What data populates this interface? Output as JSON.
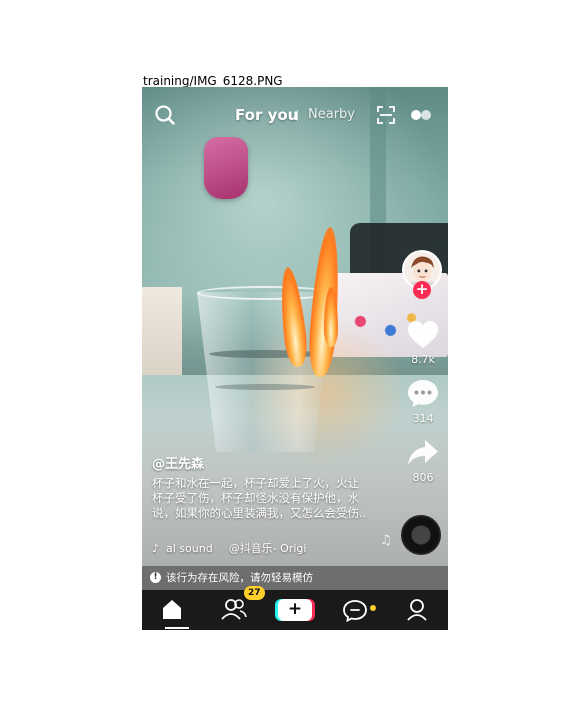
{
  "file_caption": "training/IMG_6128.PNG",
  "top_bar": {
    "tab_for_you": "For you",
    "tab_nearby": "Nearby",
    "icons": [
      "search-icon",
      "scan-icon",
      "record-icon"
    ]
  },
  "right_rail": {
    "like_count": "8.7k",
    "comment_count": "314",
    "share_count": "806",
    "follow_symbol": "+"
  },
  "post": {
    "author": "@王先森",
    "caption": "杯子和水在一起，杯子却爱上了火，火让杯子受了伤，杯子却怪水没有保护他，水说，如果你的心里装满我，又怎么会受伤..",
    "sound_a": "al sound",
    "sound_b": "@抖音乐- Origi"
  },
  "warning": {
    "text": "该行为存在风险，请勿轻易模仿",
    "icon_glyph": "!"
  },
  "bottom_nav": {
    "friends_badge": "27",
    "add_symbol": "+"
  },
  "colors": {
    "accent_red": "#fe2c55",
    "accent_cyan": "#25f4ee",
    "badge_yellow": "#ffd02b",
    "nav_bg": "#1a1a1a"
  }
}
